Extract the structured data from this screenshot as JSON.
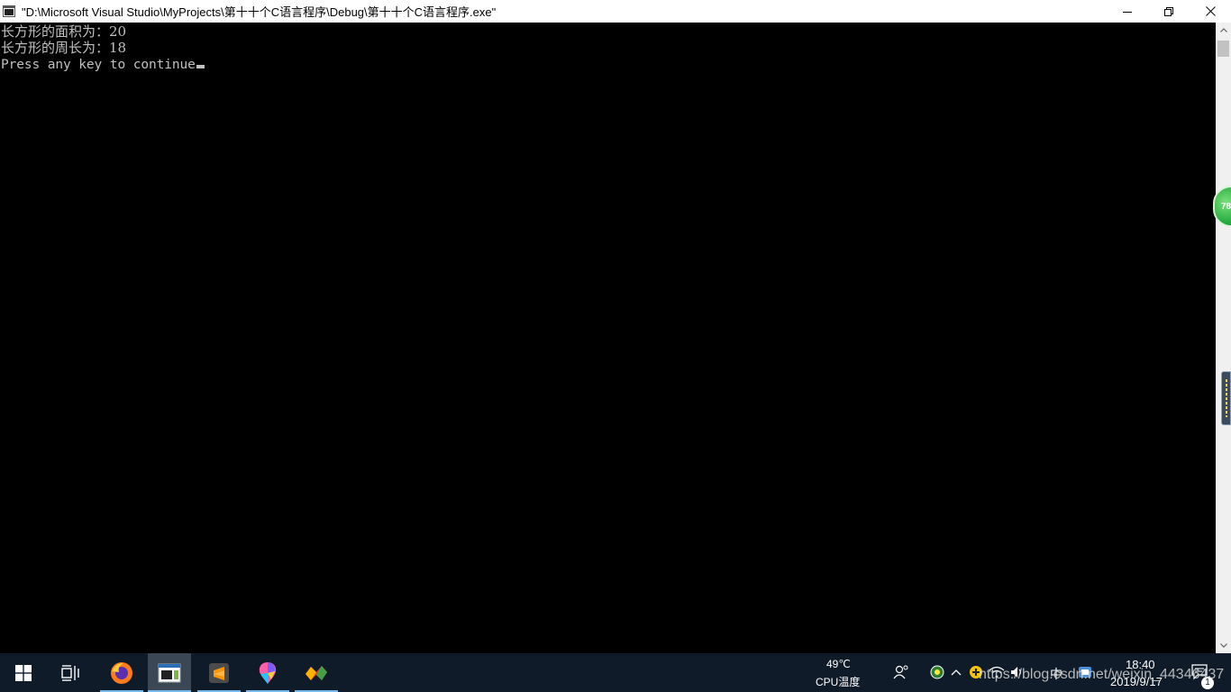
{
  "window": {
    "title": "\"D:\\Microsoft Visual Studio\\MyProjects\\第十十个C语言程序\\Debug\\第十十个C语言程序.exe\""
  },
  "console": {
    "lines": [
      "长方形的面积为：20",
      "长方形的周长为：18",
      "Press any key to continue"
    ]
  },
  "float_ball": {
    "value": "78"
  },
  "tray": {
    "cpu_temp": "49℃",
    "cpu_label": "CPU温度",
    "ime": "中",
    "time": "18:40",
    "date": "2019/9/17",
    "notification_count": "1"
  },
  "watermark": "https://blog.csdn.net/weixin_44346437",
  "colors": {
    "console_bg": "#000000",
    "console_text": "#c0c0c0",
    "taskbar_bg": "#0f1b28",
    "taskbar_accent": "#76b9ed"
  }
}
